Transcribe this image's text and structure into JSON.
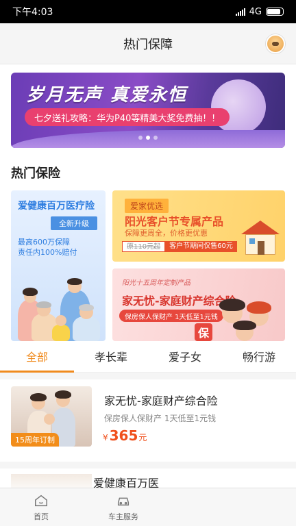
{
  "status_bar": {
    "time": "下午4:03",
    "network": "4G"
  },
  "header": {
    "title": "热门保障"
  },
  "banner": {
    "headline": "岁月无声 真爱永恒",
    "promo": "七夕送礼攻略：华为P40等精美大奖免费抽！！",
    "dots": 3,
    "active_dot": 1
  },
  "section": {
    "title": "热门保险"
  },
  "card_left": {
    "title": "爱健康百万医疗险",
    "tag": "全新升级",
    "line1": "最高600万保障",
    "line2": "责任内100%赔付"
  },
  "card_right_top": {
    "badge": "爱家优选",
    "title": "阳光客户节专属产品",
    "subtitle": "保障更周全，价格更优惠",
    "old_price": "原110元起",
    "new_price": "客户节期间仅售60元"
  },
  "card_right_bottom": {
    "kicker": "阳光十五周年定制产品",
    "title": "家无忧-家庭财产综合险",
    "pill": "保房保人保财产  1天低至1元钱",
    "seal": "保"
  },
  "tabs": [
    {
      "label": "全部",
      "active": true
    },
    {
      "label": "孝长辈",
      "active": false
    },
    {
      "label": "爱子女",
      "active": false
    },
    {
      "label": "畅行游",
      "active": false
    }
  ],
  "products": [
    {
      "name": "家无忧-家庭财产综合险",
      "desc": "保房保人保财产  1天低至1元钱",
      "currency": "¥",
      "price": "365",
      "unit": "元",
      "ribbon": "15周年订制"
    },
    {
      "name": "爱健康百万医"
    }
  ],
  "bottom_nav": [
    {
      "label": "首页",
      "icon": "home-icon"
    },
    {
      "label": "车主服务",
      "icon": "car-icon"
    }
  ],
  "colors": {
    "accent": "#f08a1c",
    "price": "#f0501c"
  }
}
